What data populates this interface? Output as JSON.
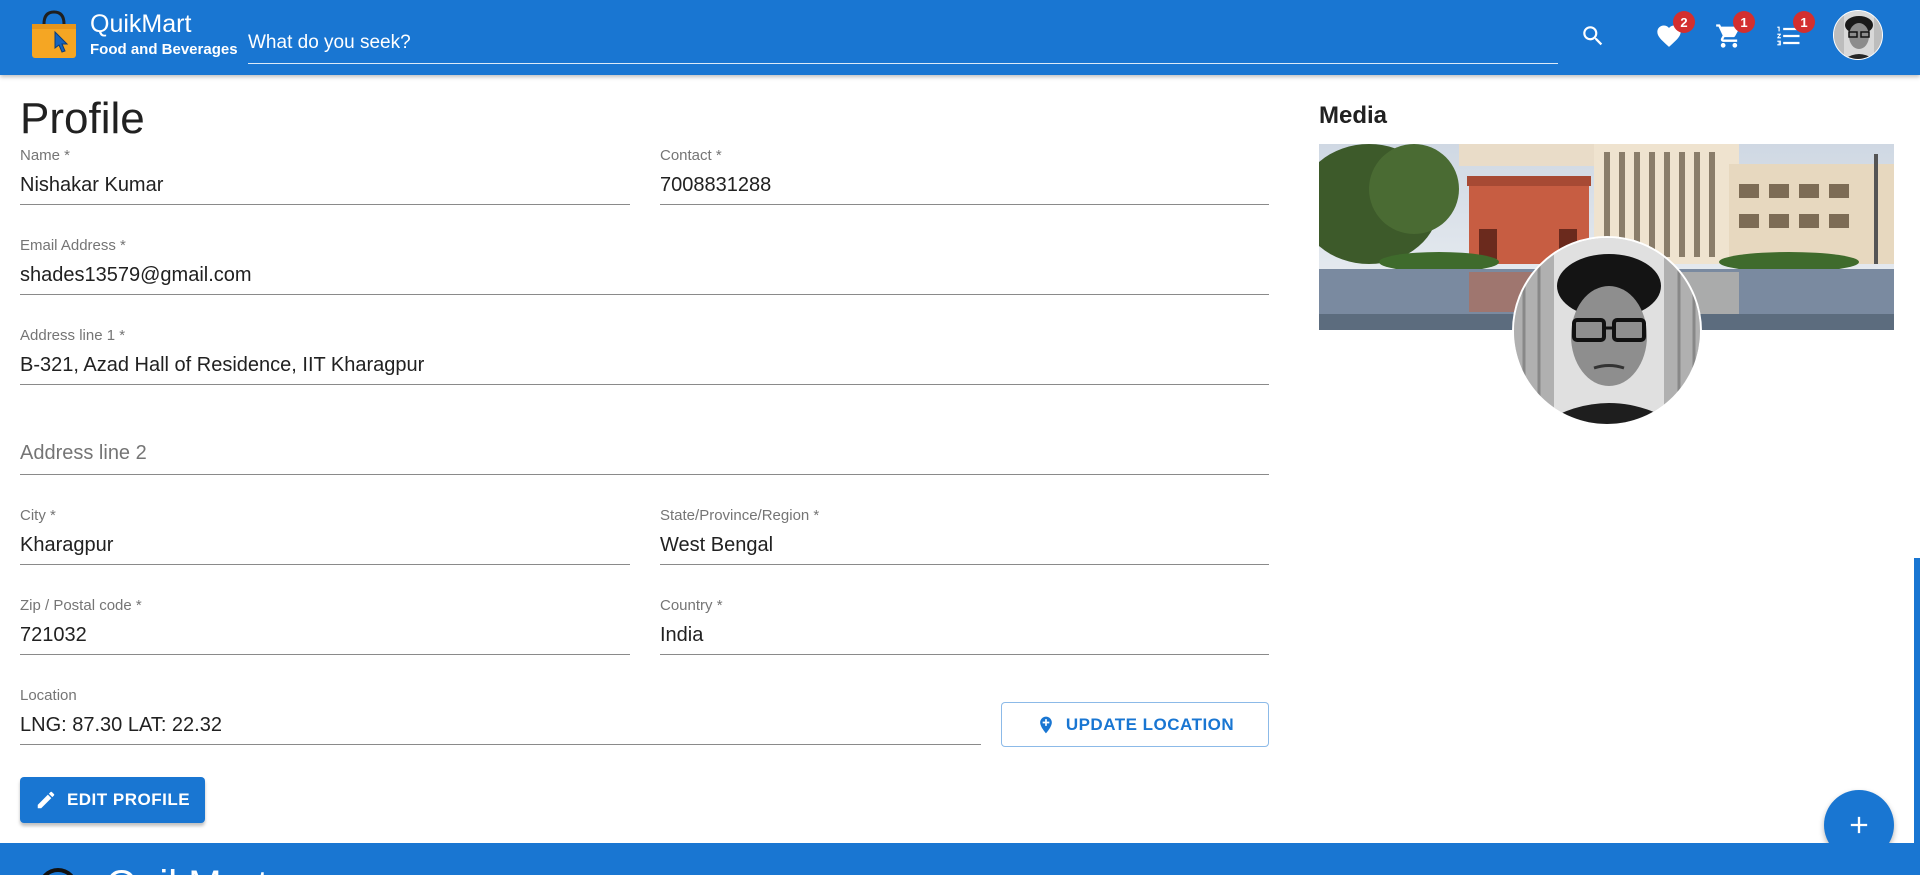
{
  "header": {
    "brand_title": "QuikMart",
    "brand_subtitle": "Food and Beverages",
    "search_placeholder": "What do you seek?",
    "wishlist_count": "2",
    "cart_count": "1",
    "orders_count": "1",
    "icons": [
      "shopping-bag-icon",
      "search-icon",
      "heart-icon",
      "cart-icon",
      "list-icon"
    ]
  },
  "profile": {
    "title": "Profile",
    "fields": {
      "name": {
        "label": "Name *",
        "value": "Nishakar Kumar"
      },
      "contact": {
        "label": "Contact *",
        "value": "7008831288"
      },
      "email": {
        "label": "Email Address *",
        "value": "shades13579@gmail.com"
      },
      "address1": {
        "label": "Address line 1 *",
        "value": "B-321, Azad Hall of Residence, IIT Kharagpur"
      },
      "address2": {
        "placeholder": "Address line 2"
      },
      "city": {
        "label": "City *",
        "value": "Kharagpur"
      },
      "state": {
        "label": "State/Province/Region *",
        "value": "West Bengal"
      },
      "zip": {
        "label": "Zip / Postal code *",
        "value": "721032"
      },
      "country": {
        "label": "Country *",
        "value": "India"
      },
      "location": {
        "label": "Location",
        "value": "LNG: 87.30 LAT: 22.32"
      }
    },
    "update_location_label": "UPDATE LOCATION",
    "edit_profile_label": "EDIT PROFILE"
  },
  "media": {
    "title": "Media"
  },
  "footer": {
    "brand": "QuikMart"
  },
  "colors": {
    "primary": "#1976d2",
    "badge": "#d32f2f",
    "logo_bag": "#f5a623"
  }
}
